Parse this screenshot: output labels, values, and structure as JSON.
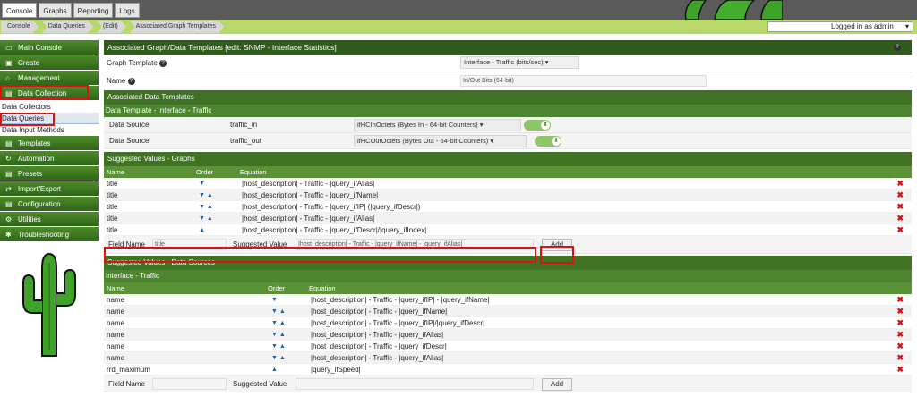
{
  "tabs": [
    "Console",
    "Graphs",
    "Reporting",
    "Logs"
  ],
  "breadcrumbs": [
    "Console",
    "Data Queries",
    "(Edit)",
    "Associated Graph Templates"
  ],
  "login_text": "Logged in as admin",
  "login_caret": "▾",
  "sidebar": {
    "items": [
      {
        "label": "Main Console",
        "icon": "▭"
      },
      {
        "label": "Create",
        "icon": "▣"
      },
      {
        "label": "Management",
        "icon": "⌂"
      },
      {
        "label": "Data Collection",
        "icon": "▤"
      }
    ],
    "subitems": [
      "Data Collectors",
      "Data Queries",
      "Data Input Methods"
    ],
    "items2": [
      {
        "label": "Templates",
        "icon": "▤"
      },
      {
        "label": "Automation",
        "icon": "↻"
      },
      {
        "label": "Presets",
        "icon": "▤"
      },
      {
        "label": "Import/Export",
        "icon": "⇄"
      },
      {
        "label": "Configuration",
        "icon": "▤"
      },
      {
        "label": "Utilities",
        "icon": "⚙"
      },
      {
        "label": "Troubleshooting",
        "icon": "✱"
      }
    ]
  },
  "main": {
    "title": "Associated Graph/Data Templates [edit: SNMP - Interface Statistics]",
    "graph_template_label": "Graph Template",
    "graph_template_value": "Interface - Traffic (bits/sec)",
    "name_label": "Name",
    "name_value": "In/Out Bits (64-bit)",
    "assoc_header": "Associated Data Templates",
    "data_template_header": "Data Template - Interface - Traffic",
    "data_sources": [
      {
        "label": "Data Source",
        "name": "traffic_in",
        "value": "ifHCInOctets (Bytes In - 64-bit Counters)"
      },
      {
        "label": "Data Source",
        "name": "traffic_out",
        "value": "ifHCOutOctets (Bytes Out - 64-bit Counters)"
      }
    ],
    "sv_graphs_header": "Suggested Values - Graphs",
    "columns": {
      "name": "Name",
      "order": "Order",
      "equation": "Equation"
    },
    "graph_rows": [
      {
        "name": "title",
        "order": "▼",
        "equation": "|host_description| - Traffic - |query_ifAlias|"
      },
      {
        "name": "title",
        "order": "▼ ▲",
        "equation": "|host_description| - Traffic - |query_ifName|"
      },
      {
        "name": "title",
        "order": "▼ ▲",
        "equation": "|host_description| - Traffic - |query_ifIP| (|query_ifDescr|)"
      },
      {
        "name": "title",
        "order": "▼ ▲",
        "equation": "|host_description| - Traffic - |query_ifAlias|"
      },
      {
        "name": "title",
        "order": "▲",
        "equation": "|host_description| - Traffic - |query_ifDescr|/|query_ifIndex|"
      }
    ],
    "graph_form": {
      "field_name_label": "Field Name",
      "field_name_value": "title",
      "suggested_label": "Suggested Value",
      "suggested_value": "|host_description| - Traffic - |query_ifName| - |query_ifAlias|",
      "add_label": "Add"
    },
    "sv_ds_header": "Suggested Values - Data Sources",
    "ds_template_header": "Interface - Traffic",
    "ds_rows": [
      {
        "name": "name",
        "order": "▼",
        "equation": "|host_description| - Traffic - |query_ifIP| - |query_ifName|"
      },
      {
        "name": "name",
        "order": "▼ ▲",
        "equation": "|host_description| - Traffic - |query_ifName|"
      },
      {
        "name": "name",
        "order": "▼ ▲",
        "equation": "|host_description| - Traffic - |query_ifIP|/|query_ifDescr|"
      },
      {
        "name": "name",
        "order": "▼ ▲",
        "equation": "|host_description| - Traffic - |query_ifAlias|"
      },
      {
        "name": "name",
        "order": "▼ ▲",
        "equation": "|host_description| - Traffic - |query_ifDescr|"
      },
      {
        "name": "name",
        "order": "▼ ▲",
        "equation": "|host_description| - Traffic - |query_ifAlias|"
      },
      {
        "name": "rrd_maximum",
        "order": "▲",
        "equation": "|query_ifSpeed|"
      }
    ],
    "ds_form": {
      "field_name_label": "Field Name",
      "suggested_label": "Suggested Value",
      "add_label": "Add"
    },
    "delete_glyph": "✖",
    "help_glyph": "?"
  },
  "colors": {
    "dark_green": "#2f5b1c",
    "mid_green": "#3f7323",
    "accent_red": "#e01010",
    "delete_red": "#d0101a"
  }
}
